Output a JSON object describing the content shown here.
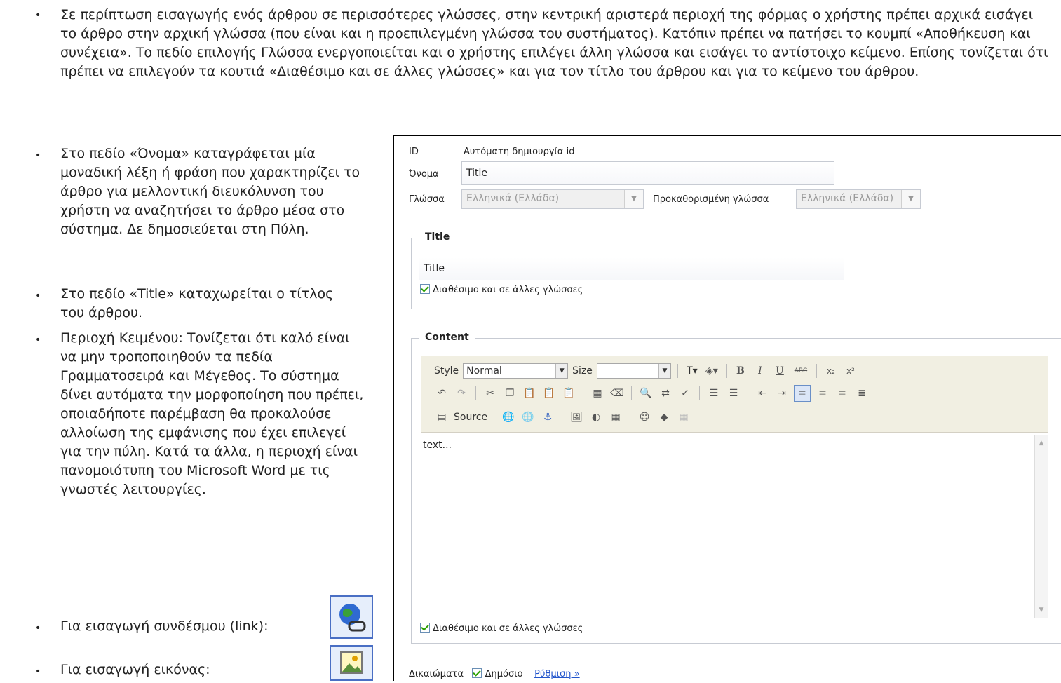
{
  "intro": {
    "text": "Σε περίπτωση εισαγωγής ενός άρθρου σε περισσότερες γλώσσες, στην κεντρική αριστερά περιοχή της  φόρμας ο χρήστης πρέπει αρχικά εισάγει το άρθρο στην αρχική γλώσσα (που είναι και η προεπιλεγμένη γλώσσα του συστήματος). Κατόπιν πρέπει να πατήσει το κουμπί «Αποθήκευση και συνέχεια». Το πεδίο επιλογής Γλώσσα ενεργοποιείται και ο χρήστης επιλέγει άλλη γλώσσα και εισάγει το αντίστοιχο κείμενο.  Επίσης τονίζεται ότι πρέπει να επιλεγούν τα κουτιά «Διαθέσιμο και σε άλλες γλώσσες» και για τον τίτλο του άρθρου και για το κείμενο του άρθρου."
  },
  "bullets": {
    "onoma": "Στο πεδίο «Όνομα» καταγράφεται μία μοναδική λέξη ή φράση που χαρακτηρίζει το άρθρο για μελλοντική διευκόλυνση του χρήστη να  αναζητήσει το άρθρο μέσα στο σύστημα. Δε δημοσιεύεται στη Πύλη.",
    "title": "Στο πεδίο «Title» καταχωρείται ο τίτλος του άρθρου.",
    "content": "Περιοχή Κειμένου: Τονίζεται ότι καλό είναι να μην τροποποιηθούν τα πεδία Γραμματοσειρά και Μέγεθος. Το σύστημα δίνει αυτόματα την μορφοποίηση  που πρέπει, οποιαδήποτε παρέμβαση θα προκαλούσε αλλοίωση της εμφάνισης που έχει επιλεγεί για την πύλη. Κατά τα άλλα, η περιοχή είναι πανομοιότυπη του Microsoft Word με τις γνωστές λειτουργίες.",
    "link": "Για εισαγωγή συνδέσμου (link):",
    "image": "Για εισαγωγή εικόνας:"
  },
  "form": {
    "id_label": "ID",
    "id_value": "Αυτόματη δημιουργία id",
    "name_label": "Όνομα",
    "name_value": "Title",
    "lang_label": "Γλώσσα",
    "lang_value": "Ελληνικά (Ελλάδα)",
    "default_lang_label": "Προκαθορισμένη γλώσσα",
    "default_lang_value": "Ελληνικά (Ελλάδα)",
    "title_legend": "Title",
    "title_value": "Title",
    "available_label": "Διαθέσιμο και σε άλλες γλώσσες",
    "content_legend": "Content",
    "editor_text": "text...",
    "rights_label": "Δικαιώματα",
    "public_label": "Δημόσιο",
    "settings_link": "Ρύθμιση »"
  },
  "toolbar": {
    "style_label": "Style",
    "style_value": "Normal",
    "size_label": "Size",
    "size_value": "",
    "source_label": "Source",
    "bold": "B",
    "italic": "I",
    "underline": "U",
    "strike": "ABC"
  }
}
